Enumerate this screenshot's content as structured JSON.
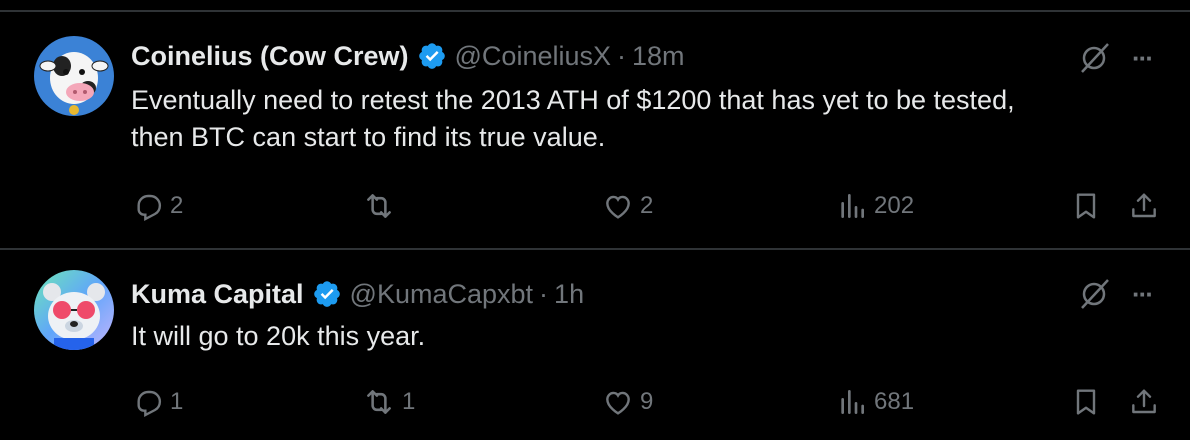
{
  "tweets": [
    {
      "name": "Coinelius (Cow Crew)",
      "handle": "@CoineliusX",
      "separator": "·",
      "time": "18m",
      "text_line1": "Eventually need to retest the 2013 ATH of $1200 that has yet to be tested,",
      "text_line2": "then BTC can start to find its true value.",
      "replies": "2",
      "retweets": "",
      "likes": "2",
      "views": "202",
      "more": "···"
    },
    {
      "name": "Kuma Capital",
      "handle": "@KumaCapxbt",
      "separator": "·",
      "time": "1h",
      "text_line1": "It will go to 20k this year.",
      "replies": "1",
      "retweets": "1",
      "likes": "9",
      "views": "681",
      "more": "···"
    }
  ],
  "colors": {
    "background": "#000000",
    "text": "#e7e9ea",
    "muted": "#71767b",
    "divider": "#2f3336",
    "verified": "#1d9bf0"
  },
  "icons": [
    "verified-badge-icon",
    "grok-icon",
    "more-icon",
    "reply-icon",
    "retweet-icon",
    "like-icon",
    "views-icon",
    "bookmark-icon",
    "share-icon"
  ]
}
